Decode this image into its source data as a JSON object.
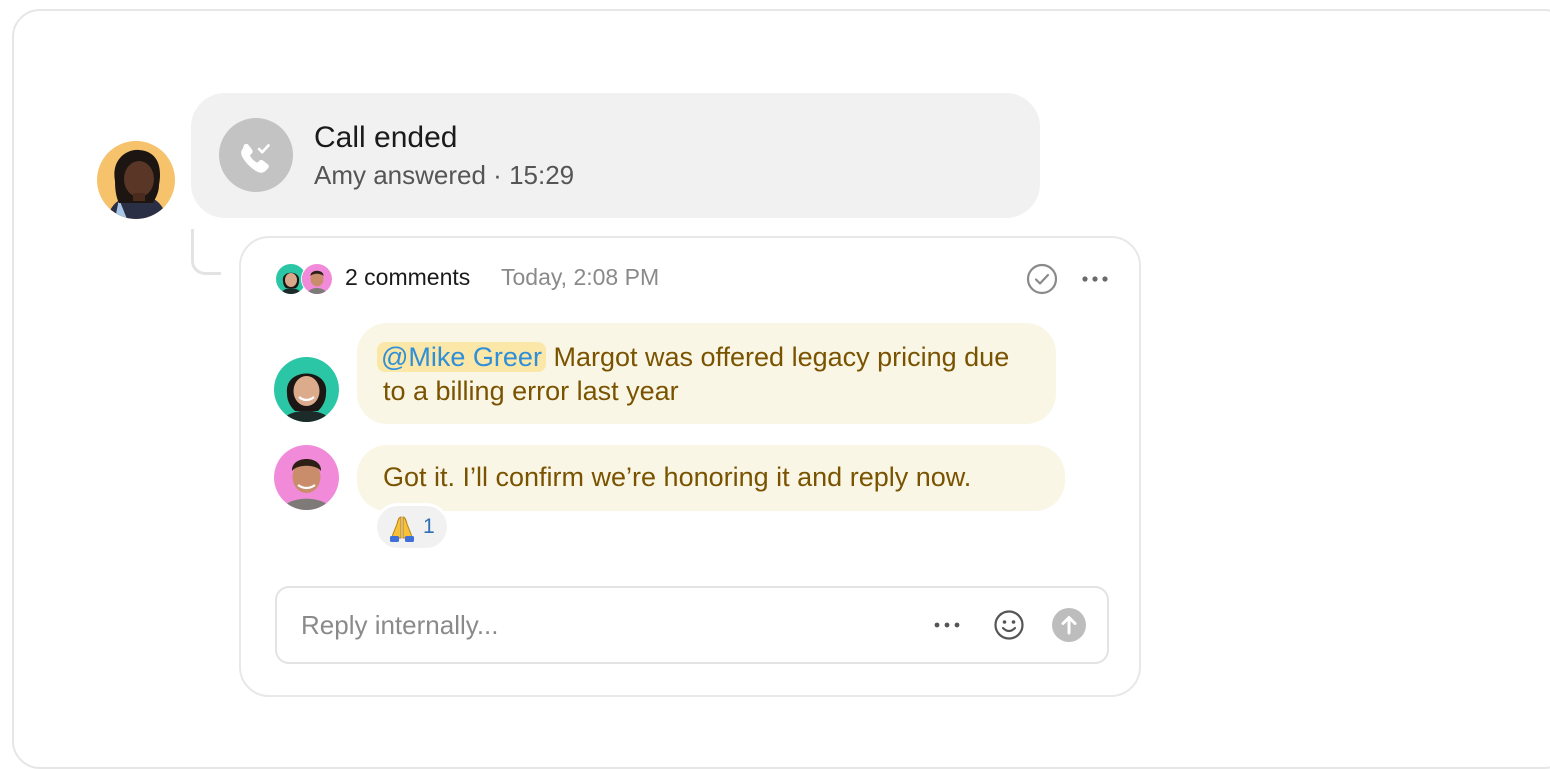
{
  "call": {
    "title": "Call ended",
    "subtitle": "Amy answered · 15:29",
    "icon": "phone-check-icon"
  },
  "thread": {
    "count_label": "2 comments",
    "timestamp": "Today, 2:08 PM",
    "comments": [
      {
        "mention": "@Mike Greer",
        "text": "Margot was offered legacy pricing due to a billing error last year"
      },
      {
        "text": "Got it. I’ll confirm we’re honoring it and reply now.",
        "reaction": {
          "emoji": "🙏",
          "count": "1"
        }
      }
    ]
  },
  "reply": {
    "placeholder": "Reply internally..."
  },
  "colors": {
    "comment_bubble": "#faf6e6",
    "comment_text": "#7a5300",
    "mention_bg": "#fbe7a8",
    "mention_text": "#2f8ed8",
    "call_card": "#f1f1f1"
  }
}
